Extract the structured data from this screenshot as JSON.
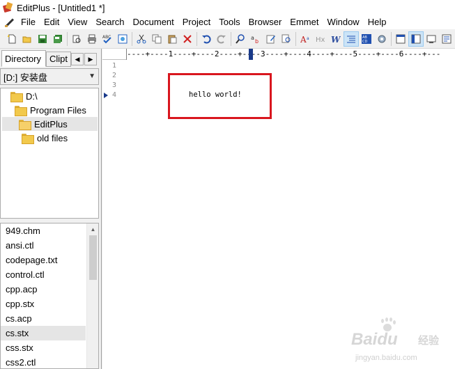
{
  "window": {
    "title": "EditPlus - [Untitled1 *]"
  },
  "menu": {
    "items": [
      "File",
      "Edit",
      "View",
      "Search",
      "Document",
      "Project",
      "Tools",
      "Browser",
      "Emmet",
      "Window",
      "Help"
    ]
  },
  "toolbar": {
    "buttons": [
      "new-file-icon",
      "open-file-icon",
      "save-icon",
      "save-all-icon",
      "print-preview-icon",
      "print-icon",
      "spell-check-icon",
      "browser-view-icon",
      "cut-icon",
      "copy-icon",
      "paste-icon",
      "delete-icon",
      "undo-icon",
      "redo-icon",
      "find-icon",
      "replace-icon",
      "edit-icon",
      "find-in-files-icon",
      "font-icon",
      "hex-icon",
      "word-wrap-icon",
      "line-number-icon",
      "column-select-icon",
      "settings-icon",
      "output-window-icon",
      "directory-window-icon",
      "screen-icon",
      "cliptext-icon"
    ],
    "active_buttons": [
      "line-number-icon",
      "directory-window-icon"
    ],
    "labels": {
      "hex": "Hx",
      "word_wrap": "W",
      "abcd": "AB CD"
    }
  },
  "sidebar": {
    "tabs": [
      {
        "label": "Directory",
        "active": true
      },
      {
        "label": "Clipt",
        "active": false
      }
    ],
    "drive": "[D:] 安装盘",
    "tree": [
      {
        "label": "D:\\",
        "level": 0,
        "selected": false
      },
      {
        "label": "Program Files",
        "level": 1,
        "selected": false
      },
      {
        "label": "EditPlus",
        "level": 2,
        "selected": true
      },
      {
        "label": "old files",
        "level": 3,
        "selected": false
      }
    ],
    "files": [
      "949.chm",
      "ansi.ctl",
      "codepage.txt",
      "control.ctl",
      "cpp.acp",
      "cpp.stx",
      "cs.acp",
      "cs.stx",
      "css.stx",
      "css2.ctl"
    ],
    "selected_file": "cs.stx"
  },
  "editor": {
    "ruler": "----+----1----+----2----+----3----+----4----+----5----+----6----+---",
    "line_numbers": [
      "1",
      "2",
      "3",
      "4"
    ],
    "current_line": 4,
    "lines": [
      "",
      "",
      "",
      "hello world!"
    ],
    "highlight_color": "#d9161e"
  },
  "watermark": {
    "brand": "Baidu",
    "cn": "经验",
    "url": "jingyan.baidu.com"
  }
}
